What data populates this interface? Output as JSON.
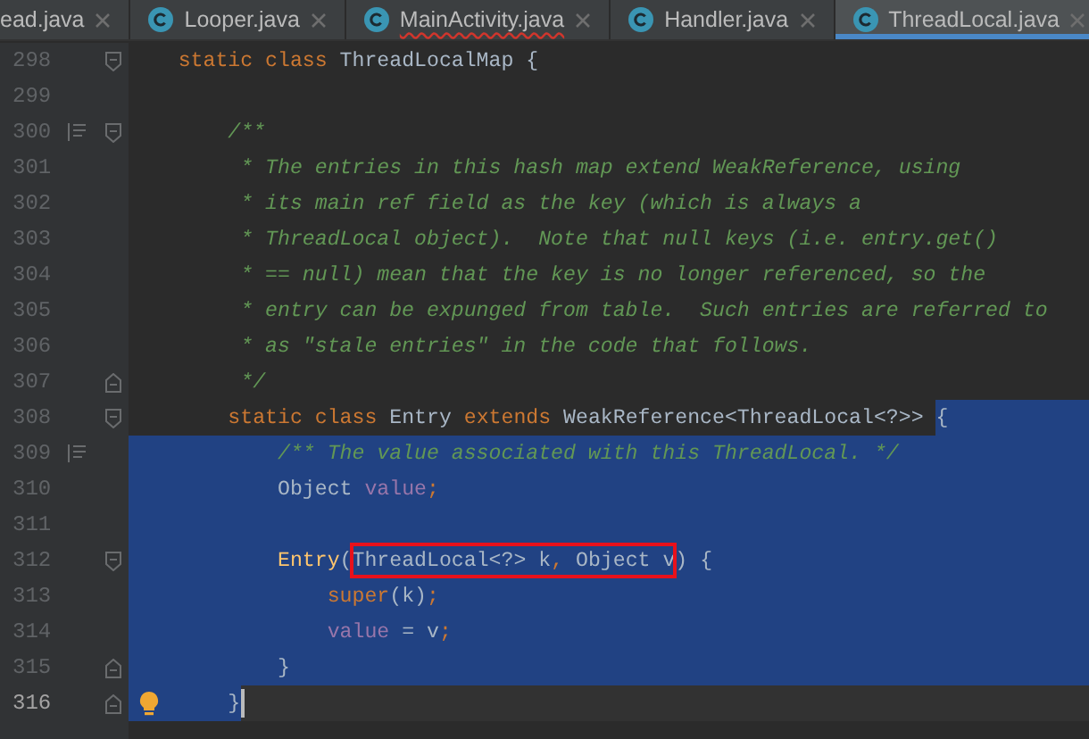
{
  "tabs": [
    {
      "label": "ead.java",
      "selected": false,
      "clipped": true,
      "has_error": false
    },
    {
      "label": "Looper.java",
      "selected": false,
      "clipped": false,
      "has_error": false
    },
    {
      "label": "MainActivity.java",
      "selected": false,
      "clipped": false,
      "has_error": true
    },
    {
      "label": "Handler.java",
      "selected": false,
      "clipped": false,
      "has_error": false
    },
    {
      "label": "ThreadLocal.java",
      "selected": true,
      "clipped": false,
      "has_error": false
    }
  ],
  "lines": [
    {
      "number": "298",
      "fold_start": true,
      "tokens": [
        {
          "kind": "keyword",
          "text": "    static class "
        },
        {
          "kind": "plain",
          "text": "ThreadLocalMap {"
        }
      ]
    },
    {
      "number": "299"
    },
    {
      "number": "300",
      "fold_start": true,
      "doc_marker": true,
      "tokens": [
        {
          "kind": "comment",
          "text": "        /**"
        }
      ]
    },
    {
      "number": "301",
      "tokens": [
        {
          "kind": "comment",
          "text": "         * The entries in this hash map extend WeakReference, using"
        }
      ]
    },
    {
      "number": "302",
      "tokens": [
        {
          "kind": "comment",
          "text": "         * its main ref field as the key (which is always a"
        }
      ]
    },
    {
      "number": "303",
      "tokens": [
        {
          "kind": "comment",
          "text": "         * ThreadLocal object).  Note that null keys (i.e. entry.get()"
        }
      ]
    },
    {
      "number": "304",
      "tokens": [
        {
          "kind": "comment",
          "text": "         * == null) mean that the key is no longer referenced, so the"
        }
      ]
    },
    {
      "number": "305",
      "tokens": [
        {
          "kind": "comment",
          "text": "         * entry can be expunged from table.  Such entries are referred to"
        }
      ]
    },
    {
      "number": "306",
      "tokens": [
        {
          "kind": "comment",
          "text": "         * as \"stale entries\" in the code that follows."
        }
      ]
    },
    {
      "number": "307",
      "fold_end": true,
      "tokens": [
        {
          "kind": "comment",
          "text": "         */"
        }
      ]
    },
    {
      "number": "308",
      "fold_start": true,
      "selected": false,
      "tokens": [
        {
          "kind": "keyword",
          "text": "        static class "
        },
        {
          "kind": "plain",
          "text": "Entry "
        },
        {
          "kind": "keyword",
          "text": "extends "
        },
        {
          "kind": "plain",
          "text": "WeakReference<ThreadLocal<?>> "
        },
        {
          "kind": "plain",
          "text": "{",
          "selected": true
        }
      ]
    },
    {
      "number": "309",
      "doc_marker": true,
      "selected": true,
      "tokens": [
        {
          "kind": "comment",
          "text": "            /** The value associated with this ThreadLocal. */"
        }
      ]
    },
    {
      "number": "310",
      "selected": true,
      "tokens": [
        {
          "kind": "plain",
          "text": "            Object "
        },
        {
          "kind": "field",
          "text": "value"
        },
        {
          "kind": "keyword",
          "text": ";"
        }
      ]
    },
    {
      "number": "311",
      "selected": true
    },
    {
      "number": "312",
      "fold_start": true,
      "selected": true,
      "tokens": [
        {
          "kind": "method",
          "text": "            Entry"
        },
        {
          "kind": "plain",
          "text": "("
        },
        {
          "kind": "plain",
          "text": "ThreadLocal<?> k",
          "boxed": true
        },
        {
          "kind": "keyword",
          "text": ", ",
          "boxed": true
        },
        {
          "kind": "plain",
          "text": "Object v",
          "boxed": true
        },
        {
          "kind": "plain",
          "text": ") {"
        }
      ]
    },
    {
      "number": "313",
      "selected": true,
      "tokens": [
        {
          "kind": "keyword",
          "text": "                super"
        },
        {
          "kind": "plain",
          "text": "(k)"
        },
        {
          "kind": "keyword",
          "text": ";"
        }
      ]
    },
    {
      "number": "314",
      "selected": true,
      "tokens": [
        {
          "kind": "field",
          "text": "                value"
        },
        {
          "kind": "plain",
          "text": " = v"
        },
        {
          "kind": "keyword",
          "text": ";"
        }
      ]
    },
    {
      "number": "315",
      "fold_end": true,
      "selected": true,
      "tokens": [
        {
          "kind": "plain",
          "text": "            }"
        }
      ]
    },
    {
      "number": "316",
      "fold_end": true,
      "selected": false,
      "current": true,
      "intention": true,
      "tokens": [
        {
          "kind": "plain",
          "text": "        }",
          "selected": true
        }
      ]
    }
  ]
}
